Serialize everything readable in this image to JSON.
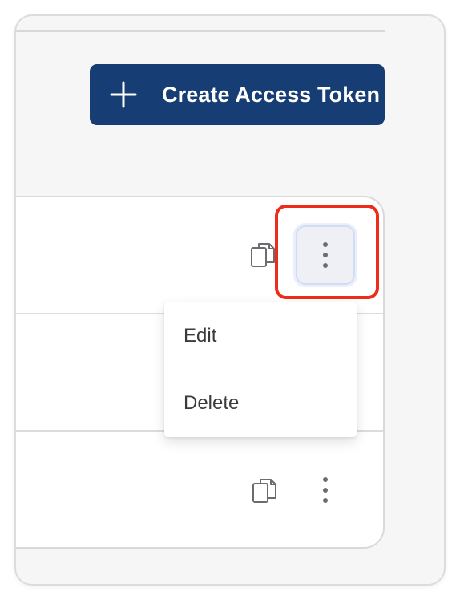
{
  "toolbar": {
    "create_button": {
      "label": "Create Access Token",
      "icon": "plus-icon"
    }
  },
  "table": {
    "rows": [
      {
        "actions": {
          "copy_icon": "copy-icon",
          "more_icon": "more-vertical-icon",
          "menu_open": true
        }
      },
      {
        "actions": {}
      },
      {
        "actions": {
          "copy_icon": "copy-icon",
          "more_icon": "more-vertical-icon",
          "menu_open": false
        }
      }
    ]
  },
  "context_menu": {
    "items": [
      {
        "label": "Edit"
      },
      {
        "label": "Delete"
      }
    ]
  },
  "colors": {
    "primary_button": "#163d74",
    "highlight": "#ee2c1b",
    "panel_background": "#f6f6f7"
  }
}
